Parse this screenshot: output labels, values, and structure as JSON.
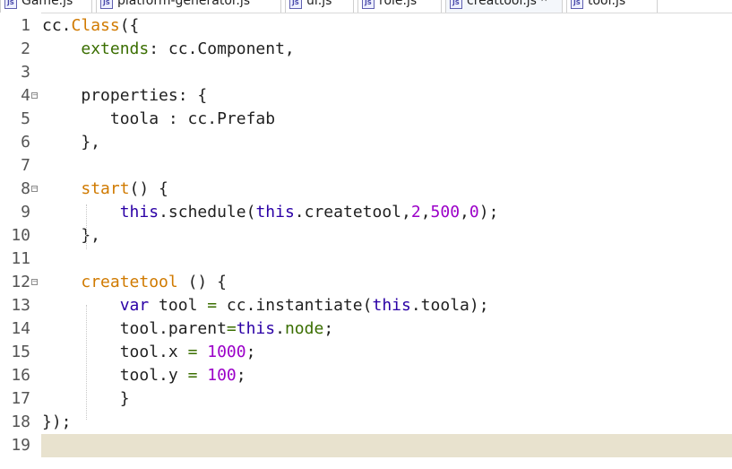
{
  "tabs": [
    {
      "label": "Game.js",
      "active": false
    },
    {
      "label": "platform-generator.js",
      "active": false
    },
    {
      "label": "ui.js",
      "active": false
    },
    {
      "label": "role.js",
      "active": false
    },
    {
      "label": "creattool.js",
      "active": true,
      "close": "✕"
    },
    {
      "label": "tool.js",
      "active": false
    }
  ],
  "tab_icon_text": "JS",
  "current_line": 19,
  "lines": [
    {
      "n": "1",
      "fold": false,
      "tokens": [
        [
          "cc.",
          "plain"
        ],
        [
          "Class",
          "orange"
        ],
        [
          "({",
          "plain"
        ]
      ]
    },
    {
      "n": "2",
      "fold": false,
      "tokens": [
        [
          "    ",
          "plain"
        ],
        [
          "extends",
          "green"
        ],
        [
          ": cc.Component,",
          "plain"
        ]
      ]
    },
    {
      "n": "3",
      "fold": false,
      "tokens": []
    },
    {
      "n": "4",
      "fold": true,
      "tokens": [
        [
          "    properties: {",
          "plain"
        ]
      ]
    },
    {
      "n": "5",
      "fold": false,
      "tokens": [
        [
          "       toola : cc.Prefab",
          "plain"
        ]
      ]
    },
    {
      "n": "6",
      "fold": false,
      "tokens": [
        [
          "    },",
          "plain"
        ]
      ]
    },
    {
      "n": "7",
      "fold": false,
      "tokens": []
    },
    {
      "n": "8",
      "fold": true,
      "tokens": [
        [
          "    ",
          "plain"
        ],
        [
          "start",
          "orange"
        ],
        [
          "() {",
          "plain"
        ]
      ]
    },
    {
      "n": "9",
      "fold": false,
      "tokens": [
        [
          "        ",
          "plain"
        ],
        [
          "this",
          "blue"
        ],
        [
          ".schedule(",
          "plain"
        ],
        [
          "this",
          "blue"
        ],
        [
          ".createtool,",
          "plain"
        ],
        [
          "2",
          "num"
        ],
        [
          ",",
          "plain"
        ],
        [
          "500",
          "num"
        ],
        [
          ",",
          "plain"
        ],
        [
          "0",
          "num"
        ],
        [
          ");",
          "plain"
        ]
      ]
    },
    {
      "n": "10",
      "fold": false,
      "tokens": [
        [
          "    },",
          "plain"
        ]
      ]
    },
    {
      "n": "11",
      "fold": false,
      "tokens": []
    },
    {
      "n": "12",
      "fold": true,
      "tokens": [
        [
          "    ",
          "plain"
        ],
        [
          "createtool",
          "orange"
        ],
        [
          " () {",
          "plain"
        ]
      ]
    },
    {
      "n": "13",
      "fold": false,
      "tokens": [
        [
          "        ",
          "plain"
        ],
        [
          "var",
          "blue"
        ],
        [
          " tool ",
          "plain"
        ],
        [
          "=",
          "op"
        ],
        [
          " cc.instantiate(",
          "plain"
        ],
        [
          "this",
          "blue"
        ],
        [
          ".toola);",
          "plain"
        ]
      ]
    },
    {
      "n": "14",
      "fold": false,
      "tokens": [
        [
          "        tool.parent",
          "plain"
        ],
        [
          "=",
          "op"
        ],
        [
          "this",
          "blue"
        ],
        [
          ".",
          "plain"
        ],
        [
          "node",
          "green"
        ],
        [
          ";",
          "plain"
        ]
      ]
    },
    {
      "n": "15",
      "fold": false,
      "tokens": [
        [
          "        tool.x ",
          "plain"
        ],
        [
          "=",
          "op"
        ],
        [
          " ",
          "plain"
        ],
        [
          "1000",
          "num"
        ],
        [
          ";",
          "plain"
        ]
      ]
    },
    {
      "n": "16",
      "fold": false,
      "tokens": [
        [
          "        tool.y ",
          "plain"
        ],
        [
          "=",
          "op"
        ],
        [
          " ",
          "plain"
        ],
        [
          "100",
          "num"
        ],
        [
          ";",
          "plain"
        ]
      ]
    },
    {
      "n": "17",
      "fold": false,
      "tokens": [
        [
          "        }",
          "plain"
        ]
      ]
    },
    {
      "n": "18",
      "fold": false,
      "tokens": [
        [
          "});",
          "plain"
        ]
      ]
    },
    {
      "n": "19",
      "fold": false,
      "tokens": []
    }
  ],
  "colors": {
    "orange": "#d07a00",
    "green": "#3a6e00",
    "blue": "#2b00a6",
    "num": "#9b00c8",
    "current_line_bg": "#e8e2ce"
  }
}
